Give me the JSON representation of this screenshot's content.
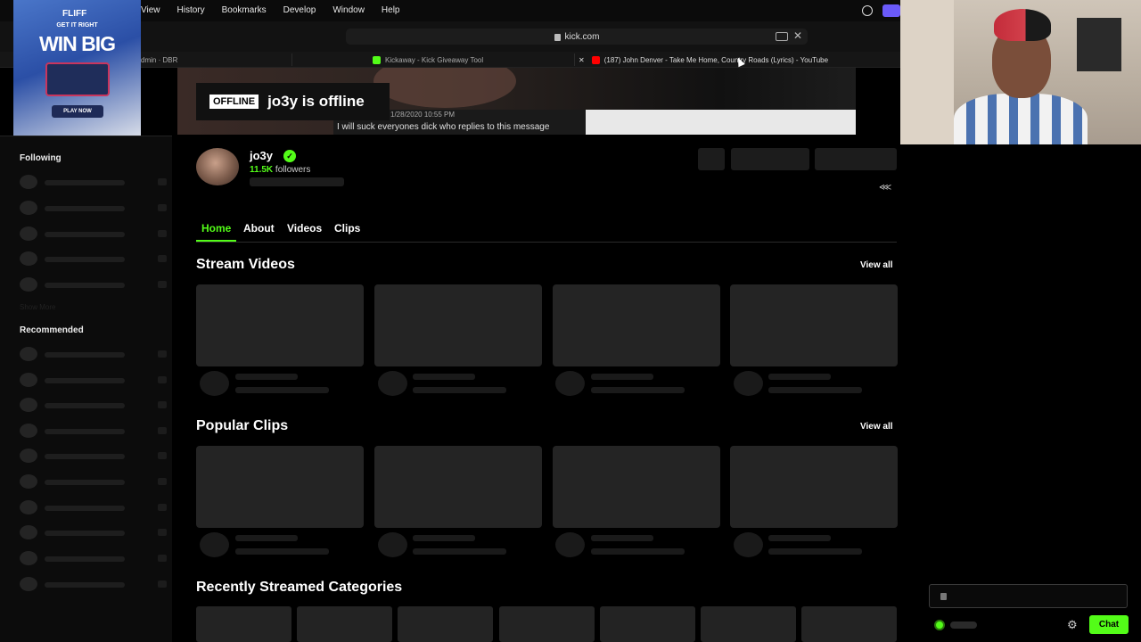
{
  "menubar": {
    "items": [
      "View",
      "History",
      "Bookmarks",
      "Develop",
      "Window",
      "Help"
    ]
  },
  "browser": {
    "url": "kick.com",
    "tabs": [
      {
        "label": "dmin · DBR",
        "favicon_color": "#333333"
      },
      {
        "label": "Kickaway - Kick Giveaway Tool",
        "favicon_color": "#53fc18"
      },
      {
        "label": "(187) John Denver - Take Me Home, Country Roads (Lyrics) - YouTube",
        "favicon_color": "#ff0000"
      }
    ]
  },
  "ad": {
    "logo": "FLIFF",
    "tagline": "GET IT RIGHT",
    "headline": "WIN BIG",
    "cta": "PLAY NOW"
  },
  "banner": {
    "badge": "OFFLINE",
    "status": "jo3y is offline",
    "date": "1/28/2020 10:55 PM",
    "message": "I will suck everyones dick who replies to this message"
  },
  "channel": {
    "name": "jo3y",
    "followers_count": "11.5K",
    "followers_label": "followers"
  },
  "sidebar": {
    "following_title": "Following",
    "show_more": "Show More",
    "recommended_title": "Recommended"
  },
  "tabs": [
    "Home",
    "About",
    "Videos",
    "Clips"
  ],
  "sections": {
    "stream_videos": "Stream Videos",
    "popular_clips": "Popular Clips",
    "categories": "Recently Streamed Categories",
    "view_all": "View all"
  },
  "chat": {
    "button": "Chat"
  },
  "colors": {
    "accent": "#53fc18",
    "background": "#0c0c0c"
  }
}
